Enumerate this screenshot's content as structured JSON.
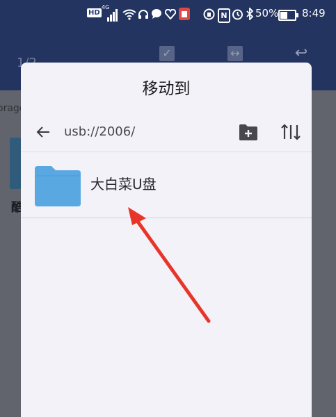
{
  "status_bar": {
    "hd": "HD",
    "network": "4G",
    "battery": "50%",
    "time": "8:49"
  },
  "background": {
    "page_count": "1/2",
    "storage_label": "orage",
    "item_name": "酷"
  },
  "dialog": {
    "title": "移动到",
    "path": "usb://2006/",
    "items": [
      {
        "name": "大白菜U盘",
        "type": "folder"
      }
    ]
  },
  "colors": {
    "app_bar": "#2d4077",
    "dialog_bg": "#f3f2f8",
    "folder": "#5aa8e2",
    "annotation_arrow": "#e8352a"
  },
  "icons": [
    "back-arrow-icon",
    "new-folder-icon",
    "sort-icon",
    "folder-icon",
    "wifi-icon",
    "alarm-icon",
    "bluetooth-icon",
    "battery-icon"
  ]
}
